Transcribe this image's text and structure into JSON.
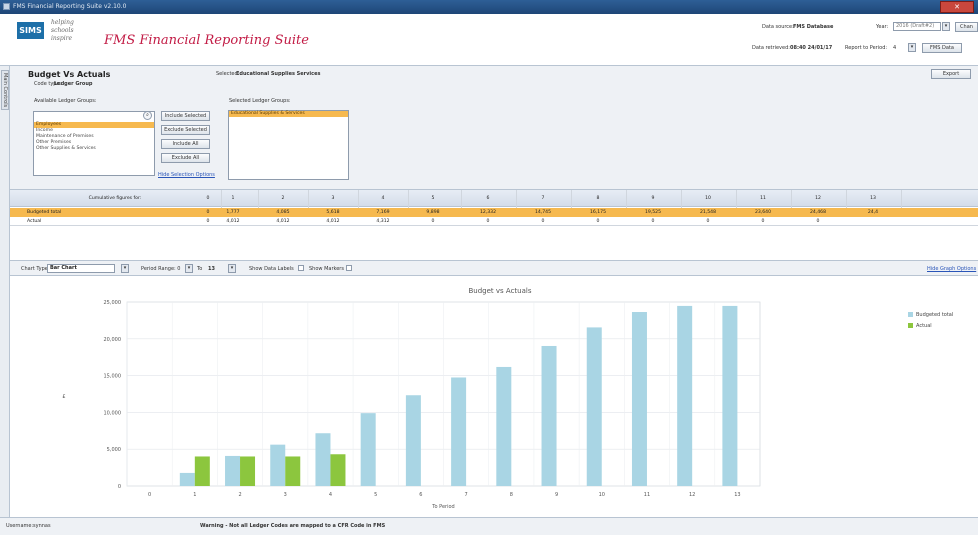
{
  "window": {
    "title": "FMS Financial Reporting Suite v2.10.0"
  },
  "header": {
    "logo": "SIMS",
    "tagline": [
      "helping",
      "schools",
      "inspire"
    ],
    "app_title": "FMS Financial Reporting Suite",
    "data_source_label": "Data source:",
    "data_source_value": "FMS Database",
    "year_label": "Year:",
    "year_value": "2016 (Draft#2)",
    "change_button": "Chan",
    "data_retrieved_label": "Data retrieved:",
    "data_retrieved_value": "08:40 24/01/17",
    "report_period_label": "Report to Period:",
    "report_period_value": "4",
    "fms_data_button": "FMS Data"
  },
  "side_tab": {
    "label": "Main Controls"
  },
  "panel": {
    "title": "Budget Vs Actuals",
    "code_type_label": "Code type:",
    "code_type_value": "Ledger Group",
    "selected_label": "Selected:",
    "selected_value": "Educational Supplies  Services",
    "export_button": "Export",
    "available_label": "Available Ledger Groups:",
    "available_items": [
      "Employees",
      "Income",
      "Maintenance of Premises",
      "Other Premises",
      "Other Supplies & Services"
    ],
    "buttons": [
      "Include Selected",
      "Exclude Selected",
      "Include All",
      "Exclude All"
    ],
    "hide_selection_link": "Hide Selection Options",
    "selected_groups_label": "Selected Ledger Groups:",
    "selected_groups_items": [
      "Educational Supplies & Services"
    ]
  },
  "grid": {
    "header_label": "Cumulative figures for:",
    "columns": [
      "0",
      "1",
      "2",
      "3",
      "4",
      "5",
      "6",
      "7",
      "8",
      "9",
      "10",
      "11",
      "12",
      "13"
    ],
    "rows": [
      {
        "label": "Budgeted total",
        "values": [
          "0",
          "1,777",
          "4,085",
          "5,618",
          "7,169",
          "9,898",
          "12,332",
          "14,745",
          "16,175",
          "19,525",
          "21,548",
          "23,640",
          "24,468",
          "24,4"
        ]
      },
      {
        "label": "Actual",
        "values": [
          "0",
          "4,012",
          "4,012",
          "4,012",
          "4,312",
          "0",
          "0",
          "0",
          "0",
          "0",
          "0",
          "0",
          "0",
          ""
        ]
      }
    ]
  },
  "toolbar": {
    "chart_type_label": "Chart Type:",
    "chart_type_value": "Bar Chart",
    "period_range_label": "Period Range: 0",
    "period_to_label": "To",
    "period_to_value": "13",
    "show_data_labels": "Show Data Labels",
    "show_markers": "Show Markers",
    "hide_graph_link": "Hide Graph Options"
  },
  "chart_data": {
    "type": "bar",
    "title": "Budget vs Actuals",
    "xlabel": "To Period",
    "ylabel": "£",
    "categories": [
      "0",
      "1",
      "2",
      "3",
      "4",
      "5",
      "6",
      "7",
      "8",
      "9",
      "10",
      "11",
      "12",
      "13"
    ],
    "ylim": [
      0,
      25000
    ],
    "yticks": [
      "0",
      "5,000",
      "10,000",
      "15,000",
      "20,000",
      "25,000"
    ],
    "grid": true,
    "legend_position": "right",
    "series": [
      {
        "name": "Budgeted total",
        "color": "#a9d5e4",
        "values": [
          0,
          1777,
          4085,
          5618,
          7169,
          9898,
          12332,
          14745,
          16175,
          19025,
          21548,
          23640,
          24468,
          24468
        ]
      },
      {
        "name": "Actual",
        "color": "#8cc63e",
        "values": [
          0,
          4012,
          4012,
          4012,
          4312,
          0,
          0,
          0,
          0,
          0,
          0,
          0,
          0,
          0
        ]
      }
    ]
  },
  "status": {
    "username_label": "Username:",
    "username_value": "synnas",
    "warning": "Warning - Not all Ledger Codes are mapped to a CFR Code in FMS"
  }
}
